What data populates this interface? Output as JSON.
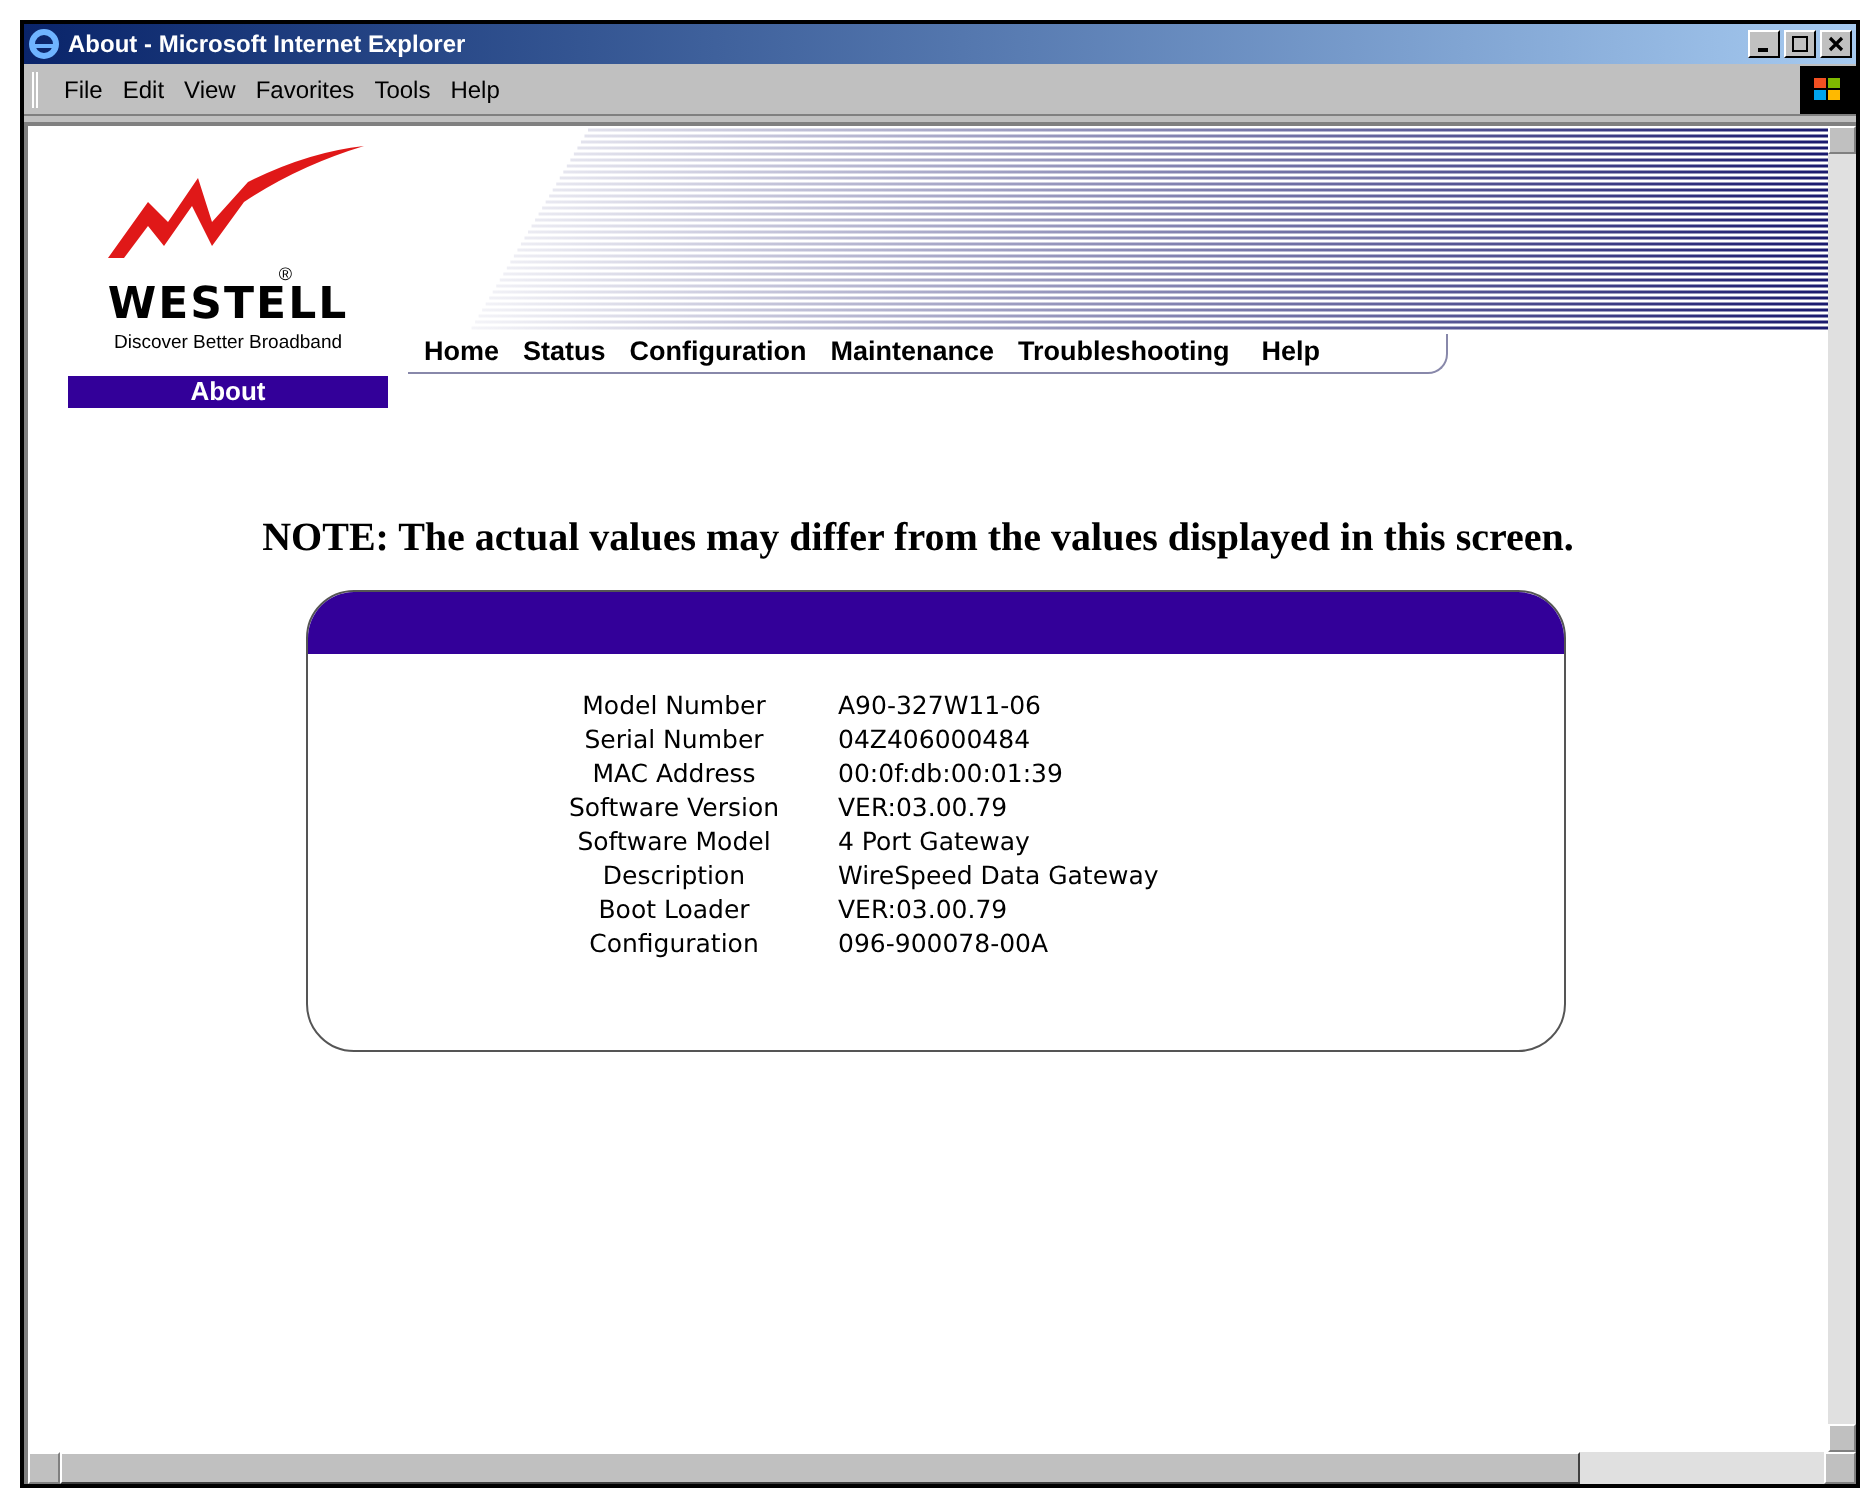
{
  "window": {
    "title": "About - Microsoft Internet Explorer"
  },
  "menu": [
    "File",
    "Edit",
    "View",
    "Favorites",
    "Tools",
    "Help"
  ],
  "logo": {
    "name": "WESTELL",
    "registered": "®",
    "tagline": "Discover Better Broadband"
  },
  "nav": [
    "Home",
    "Status",
    "Configuration",
    "Maintenance",
    "Troubleshooting",
    "Help"
  ],
  "page_label": "About",
  "note": "NOTE: The actual values may differ from the values displayed in this screen.",
  "details": [
    {
      "label": "Model Number",
      "value": "A90-327W11-06"
    },
    {
      "label": "Serial Number",
      "value": "04Z406000484"
    },
    {
      "label": "MAC Address",
      "value": "00:0f:db:00:01:39"
    },
    {
      "label": "Software Version",
      "value": "VER:03.00.79"
    },
    {
      "label": "Software Model",
      "value": "4 Port Gateway"
    },
    {
      "label": "Description",
      "value": "WireSpeed Data Gateway"
    },
    {
      "label": "Boot Loader",
      "value": "VER:03.00.79"
    },
    {
      "label": "Configuration",
      "value": "096-900078-00A"
    }
  ]
}
